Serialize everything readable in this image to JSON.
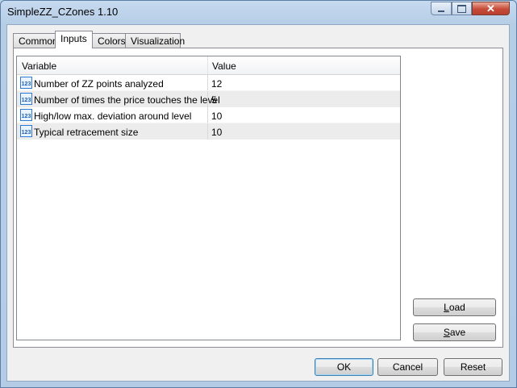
{
  "window": {
    "title": "SimpleZZ_CZones 1.10"
  },
  "tabs": [
    {
      "label": "Common"
    },
    {
      "label": "Inputs"
    },
    {
      "label": "Colors"
    },
    {
      "label": "Visualization"
    }
  ],
  "grid": {
    "columns": {
      "variable": "Variable",
      "value": "Value"
    },
    "rows": [
      {
        "icon": "numeric-123-icon",
        "variable": "Number of ZZ points analyzed",
        "value": "12"
      },
      {
        "icon": "numeric-123-icon",
        "variable": "Number of times the price touches the level",
        "value": "5"
      },
      {
        "icon": "numeric-123-icon",
        "variable": "High/low max. deviation around level",
        "value": "10"
      },
      {
        "icon": "numeric-123-icon",
        "variable": "Typical retracement size",
        "value": "10"
      }
    ]
  },
  "side_buttons": {
    "load_first": "L",
    "load_rest": "oad",
    "save_first": "S",
    "save_rest": "ave"
  },
  "footer": {
    "ok": "OK",
    "cancel": "Cancel",
    "reset": "Reset"
  }
}
